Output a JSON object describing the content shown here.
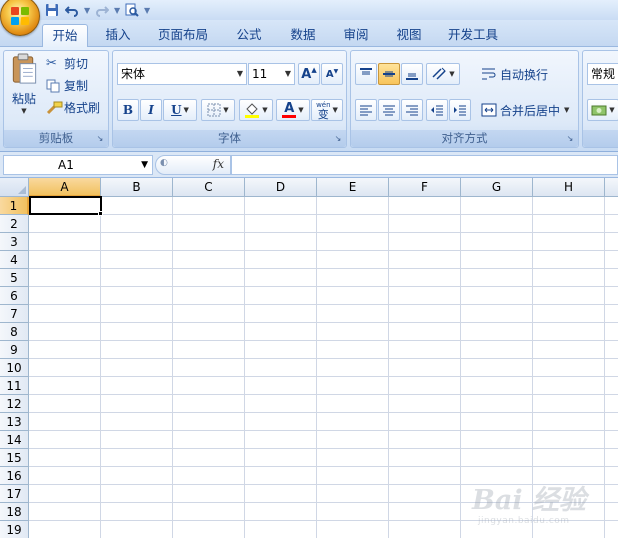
{
  "quick_access": {
    "icons": [
      "save-icon",
      "undo-icon",
      "redo-icon",
      "print-preview-icon"
    ]
  },
  "tabs": [
    {
      "label": "开始",
      "active": true
    },
    {
      "label": "插入",
      "active": false
    },
    {
      "label": "页面布局",
      "active": false
    },
    {
      "label": "公式",
      "active": false
    },
    {
      "label": "数据",
      "active": false
    },
    {
      "label": "审阅",
      "active": false
    },
    {
      "label": "视图",
      "active": false
    },
    {
      "label": "开发工具",
      "active": false
    }
  ],
  "ribbon": {
    "clipboard": {
      "label": "剪贴板",
      "paste": "粘贴",
      "cut": "剪切",
      "copy": "复制",
      "format_painter": "格式刷"
    },
    "font": {
      "label": "字体",
      "font_name": "宋体",
      "font_size": "11",
      "bold": "B",
      "italic": "I",
      "underline": "U",
      "grow": "A",
      "shrink": "A",
      "font_color_letter": "A",
      "phonetic": "变",
      "phonetic_top": "wén"
    },
    "alignment": {
      "label": "对齐方式",
      "wrap_text": "自动换行",
      "merge_center": "合并后居中"
    },
    "number": {
      "format": "常规"
    }
  },
  "formula_bar": {
    "name_box": "A1",
    "fx": "fx",
    "value": ""
  },
  "sheet": {
    "columns": [
      "A",
      "B",
      "C",
      "D",
      "E",
      "F",
      "G",
      "H"
    ],
    "rows": [
      "1",
      "2",
      "3",
      "4",
      "5",
      "6",
      "7",
      "8",
      "9",
      "10",
      "11",
      "12",
      "13",
      "14",
      "15",
      "16",
      "17",
      "18",
      "19"
    ],
    "selected_cell": "A1"
  },
  "colors": {
    "accent": "#15428b",
    "selection": "#f1c15f",
    "highlight_yellow": "#ffff00",
    "font_red": "#ff0000"
  },
  "watermark": {
    "text": "Bai 经验",
    "sub": "jingyan.baidu.com"
  }
}
